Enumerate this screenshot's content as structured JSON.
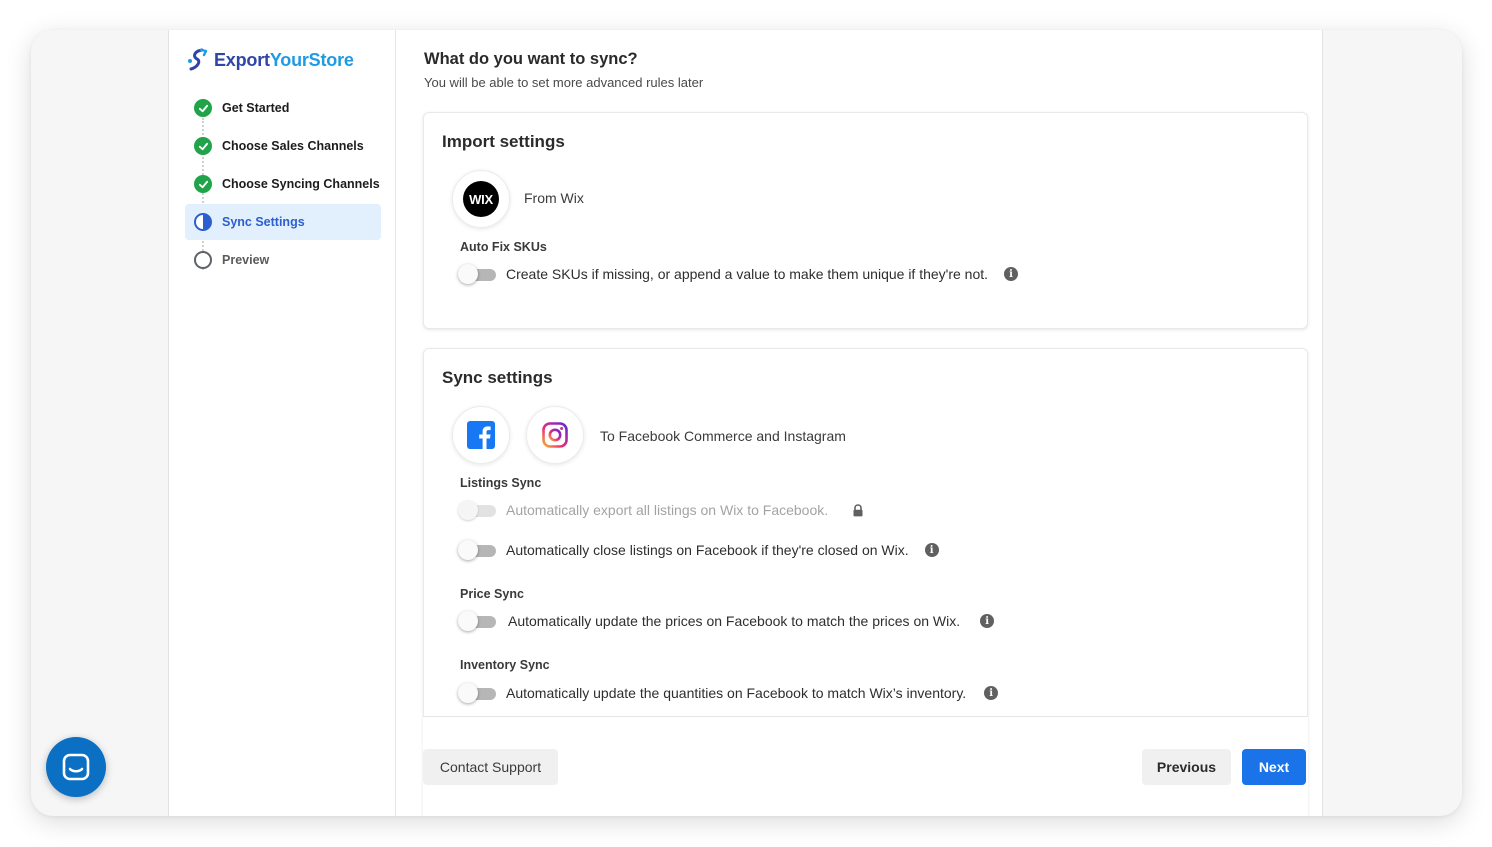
{
  "brand": {
    "name_part1": "Export",
    "name_part2": "YourStore"
  },
  "steps": [
    {
      "label": "Get Started",
      "state": "done"
    },
    {
      "label": "Choose Sales Channels",
      "state": "done"
    },
    {
      "label": "Choose Syncing Channels",
      "state": "done"
    },
    {
      "label": "Sync Settings",
      "state": "current"
    },
    {
      "label": "Preview",
      "state": "todo"
    }
  ],
  "page": {
    "title": "What do you want to sync?",
    "subtitle": "You will be able to set more advanced rules later"
  },
  "import_settings": {
    "title": "Import settings",
    "source_badge": "WIX",
    "source_label": "From Wix",
    "auto_fix_label": "Auto Fix SKUs",
    "auto_fix_text": "Create SKUs if missing, or append a value to make them unique if they're not."
  },
  "sync_settings": {
    "title": "Sync settings",
    "destination_label": "To Facebook Commerce and Instagram",
    "listings_label": "Listings Sync",
    "listings_export_text": "Automatically export all listings on Wix to Facebook.",
    "listings_close_text": "Automatically close listings on Facebook if they're closed on Wix.",
    "price_label": "Price Sync",
    "price_text": "Automatically update the prices on Facebook to match the prices on Wix.",
    "inventory_label": "Inventory Sync",
    "inventory_text": "Automatically update the quantities on Facebook to match Wix’s inventory."
  },
  "footer": {
    "support_label": "Contact Support",
    "previous_label": "Previous",
    "next_label": "Next"
  },
  "icons": {
    "info": "i",
    "logo": "exportyourstore-logo-icon",
    "facebook": "facebook-icon",
    "instagram": "instagram-icon",
    "chat": "chat-launcher-icon"
  },
  "colors": {
    "accent": "#1a73e8",
    "done_green": "#21a349",
    "active_blue": "#2c5ecf",
    "active_bg": "#e2effc",
    "facebook_blue": "#1877f2",
    "chat_blue": "#0b6fc3"
  }
}
